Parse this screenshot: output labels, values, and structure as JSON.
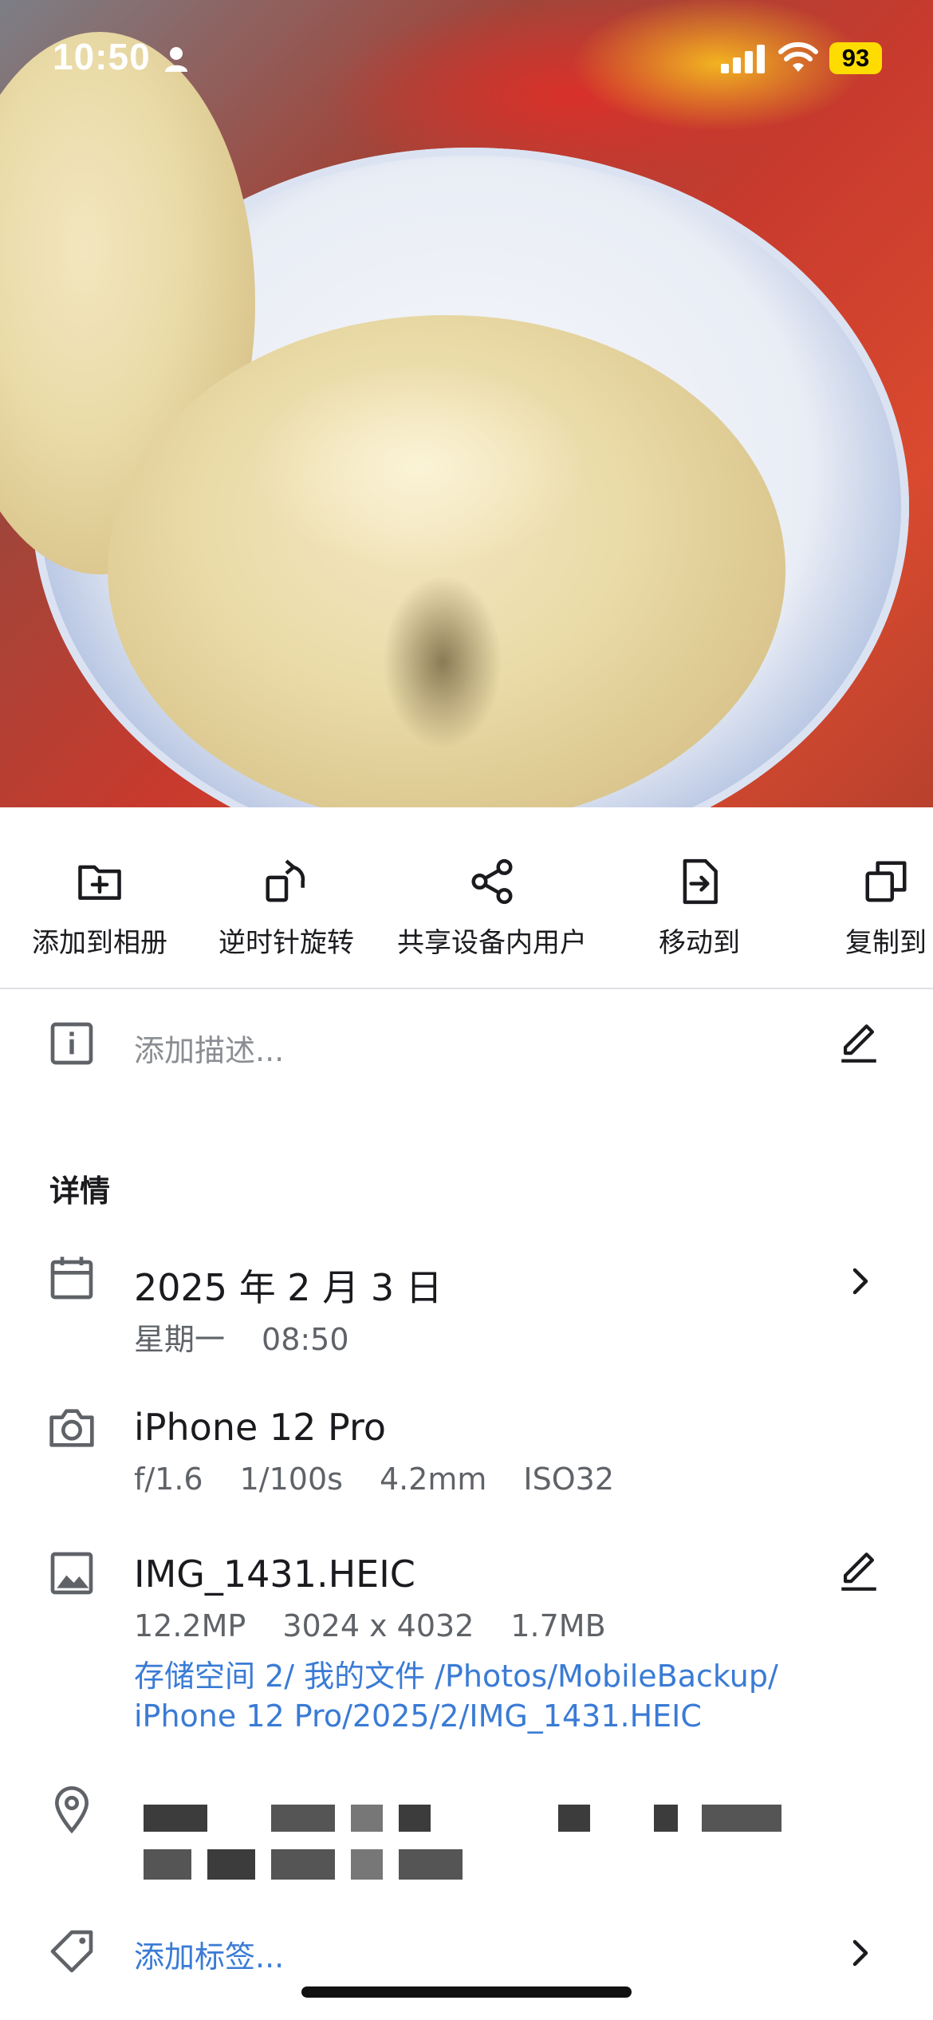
{
  "status_bar": {
    "time": "10:50",
    "battery": "93",
    "battery_color": "#ffdc00"
  },
  "photo": {
    "icon": "steamed-bun-photo"
  },
  "actions": [
    {
      "label": "添加到相册",
      "icon": "folder-plus-icon"
    },
    {
      "label": "逆时针旋转",
      "icon": "rotate-ccw-icon"
    },
    {
      "label": "共享设备内用户",
      "icon": "share-icon"
    },
    {
      "label": "移动到",
      "icon": "move-file-icon"
    },
    {
      "label": "复制到",
      "icon": "copy-icon"
    }
  ],
  "description": {
    "placeholder": "添加描述..."
  },
  "details": {
    "title": "详情",
    "date": {
      "primary": "2025 年 2 月 3 日",
      "weekday": "星期一",
      "time": "08:50"
    },
    "camera": {
      "model": "iPhone 12 Pro",
      "aperture": "f/1.6",
      "shutter": "1/100s",
      "focal": "4.2mm",
      "iso": "ISO32"
    },
    "file": {
      "name": "IMG_1431.HEIC",
      "megapixels": "12.2MP",
      "dimensions": "3024 x 4032",
      "size": "1.7MB",
      "path": "存储空间 2/ 我的文件 /Photos/MobileBackup/ iPhone 12 Pro/2025/2/IMG_1431.HEIC"
    },
    "tags": {
      "add_label": "添加标签..."
    }
  },
  "colors": {
    "link": "#3a7bd5",
    "secondary_text": "#5f6368"
  }
}
